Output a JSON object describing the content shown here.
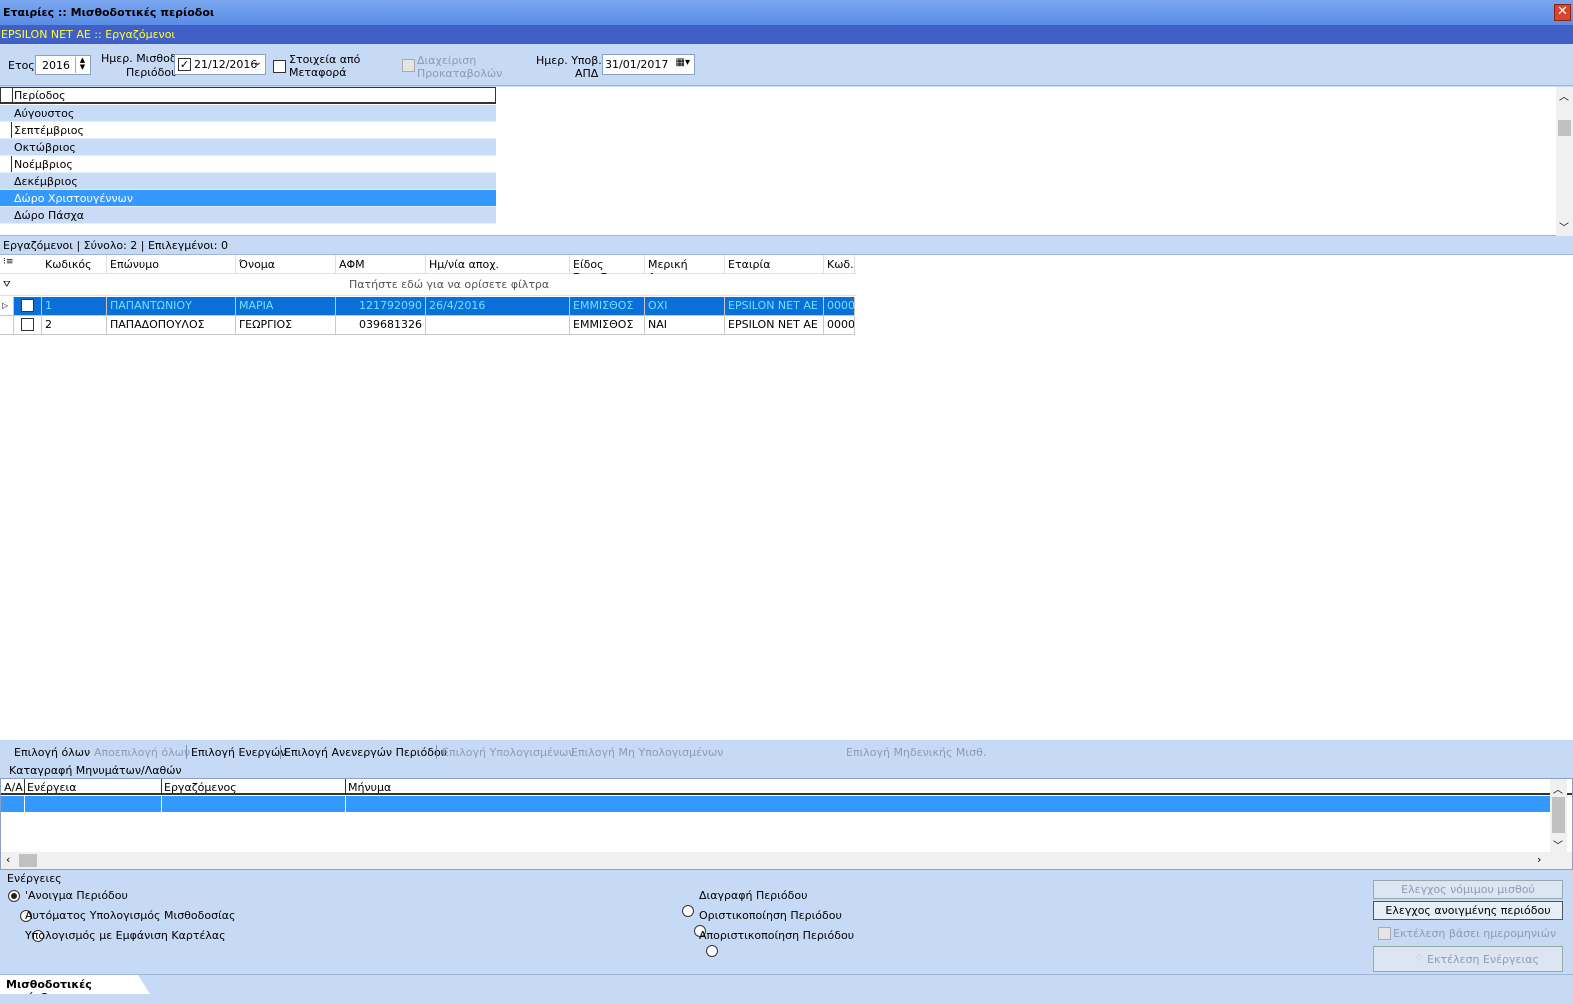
{
  "window": {
    "title": "Εταιρίες :: Μισθοδοτικές περίοδοι",
    "close": "✕"
  },
  "context": {
    "label": "EPSILON NET AE :: Εργαζόμενοι"
  },
  "toolbar": {
    "year_label": "Ετος",
    "year_value": "2016",
    "pay_date_label_1": "Ημερ. Μισθοδ.",
    "pay_date_label_2": "Περιόδου",
    "pay_date_value": "21/12/2016",
    "transfer_label_1": "Στοιχεία από",
    "transfer_label_2": "Μεταφορά",
    "advances_label_1": "Διαχείριση",
    "advances_label_2": "Προκαταβολών",
    "apd_label_1": "Ημερ. Υποβ.",
    "apd_label_2": "ΑΠΔ",
    "apd_value": "31/01/2017"
  },
  "periods": {
    "header": "Περίοδος",
    "rows": [
      "Αύγουστος",
      "Σεπτέμβριος",
      "Οκτώβριος",
      "Νοέμβριος",
      "Δεκέμβριος",
      "Δώρο Χριστουγέννων",
      "Δώρο Πάσχα"
    ],
    "selected_index": 5
  },
  "employees": {
    "summary": "Εργαζόμενοι |  Σύνολο: 2 | Επιλεγμένοι: 0",
    "columns": [
      "Κωδικός",
      "Επώνυμο",
      "Όνομα",
      "ΑΦΜ",
      "Ημ/νία αποχ.",
      "Είδος Εργαζ.",
      "Μερική Απασχ.",
      "Εταιρία",
      "Κωδ."
    ],
    "filter_hint": "Πατήστε εδώ για να ορίσετε φίλτρα",
    "rows": [
      [
        "1",
        "ΠΑΠΑΝΤΩΝΙΟΥ",
        "ΜΑΡΙΑ",
        "121792090",
        "26/4/2016",
        "ΕΜΜΙΣΘΟΣ",
        "ΟΧΙ",
        "EPSILON NET AE",
        "0000"
      ],
      [
        "2",
        "ΠΑΠΑΔΟΠΟΥΛΟΣ",
        "ΓΕΩΡΓΙΟΣ",
        "039681326",
        "",
        "ΕΜΜΙΣΘΟΣ",
        "ΝΑΙ",
        "EPSILON NET AE",
        "0000"
      ]
    ]
  },
  "selection_buttons": [
    {
      "label": "Επιλογή όλων",
      "enabled": true
    },
    {
      "label": "Αποεπιλογή όλων",
      "enabled": false
    },
    {
      "label": "Επιλογή Ενεργών",
      "enabled": true
    },
    {
      "label": "Επιλογή Ανενεργών Περιόδου",
      "enabled": true
    },
    {
      "label": "Επιλογή Υπολογισμένων",
      "enabled": false
    },
    {
      "label": "Επιλογή Μη Υπολογισμένων",
      "enabled": false
    },
    {
      "label": "Επιλογή Μηδενικής Μισθ.",
      "enabled": false
    }
  ],
  "messages": {
    "title": "Καταγραφή Μηνυμάτων/Λαθών",
    "columns": [
      "Α/Α",
      "Ενέργεια",
      "Εργαζόμενος",
      "Μήνυμα"
    ]
  },
  "actions": {
    "title": "Ενέργειες",
    "left": [
      "'Ανοιγμα Περιόδου",
      "Αυτόματος Υπολογισμός Μισθοδοσίας",
      "Υπολογισμός με Εμφάνιση Καρτέλας"
    ],
    "right": [
      "Διαγραφή Περιόδου",
      "Οριστικοποίηση Περιόδου",
      "Αποριστικοποίηση Περιόδου"
    ],
    "check_legal_salary": "Ελεγχος νόμιμου μισθού",
    "check_open_period": "Ελεγχος ανοιγμένης περιόδου",
    "run_by_dates": "Εκτέλεση βάσει ημερομηνιών",
    "execute": "Εκτέλεση Ενέργειας"
  },
  "tabs": {
    "active": "Μισθοδοτικές περίοδοι"
  }
}
